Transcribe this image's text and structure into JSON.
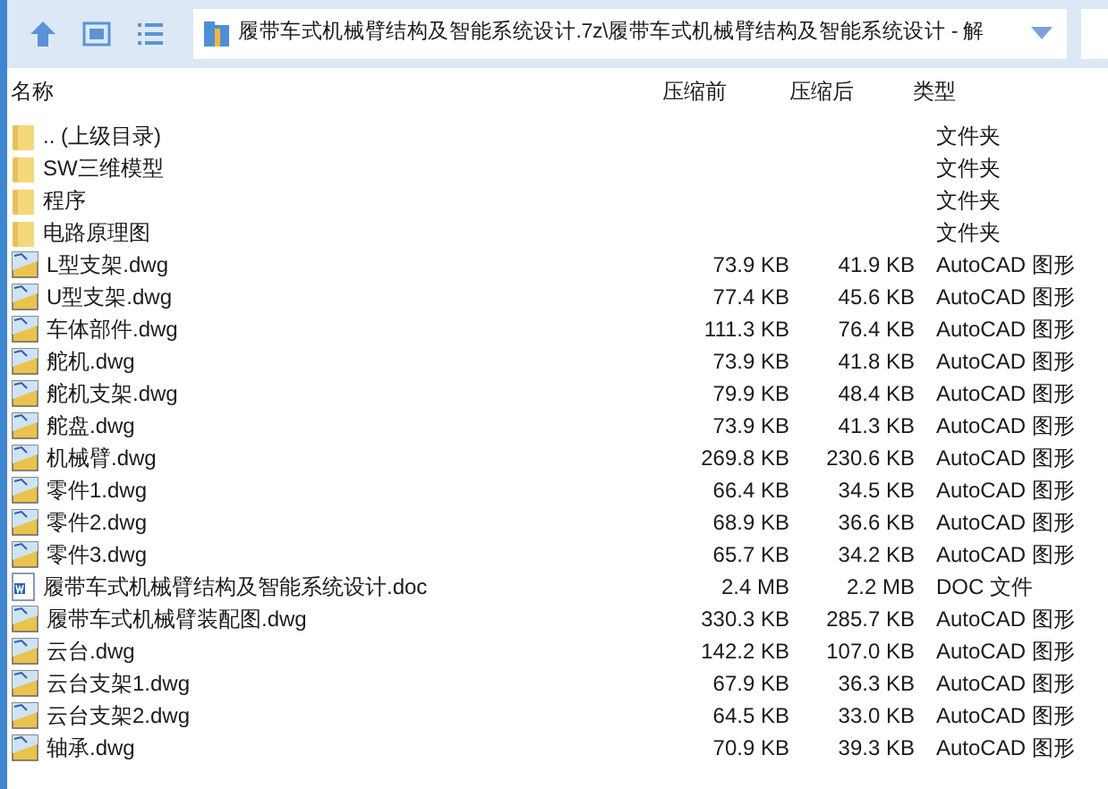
{
  "toolbar": {
    "path": "履带车式机械臂结构及智能系统设计.7z\\履带车式机械臂结构及智能系统设计 - 解"
  },
  "table": {
    "columns": [
      "名称",
      "压缩前",
      "压缩后",
      "类型"
    ],
    "rows": [
      {
        "kind": "folder",
        "name": ".. (上级目录)",
        "size": "",
        "packed": "",
        "type": "文件夹"
      },
      {
        "kind": "folder",
        "name": "SW三维模型",
        "size": "",
        "packed": "",
        "type": "文件夹"
      },
      {
        "kind": "folder",
        "name": "程序",
        "size": "",
        "packed": "",
        "type": "文件夹"
      },
      {
        "kind": "folder",
        "name": "电路原理图",
        "size": "",
        "packed": "",
        "type": "文件夹"
      },
      {
        "kind": "dwg",
        "name": "L型支架.dwg",
        "size": "73.9 KB",
        "packed": "41.9 KB",
        "type": "AutoCAD 图形"
      },
      {
        "kind": "dwg",
        "name": "U型支架.dwg",
        "size": "77.4 KB",
        "packed": "45.6 KB",
        "type": "AutoCAD 图形"
      },
      {
        "kind": "dwg",
        "name": "车体部件.dwg",
        "size": "111.3 KB",
        "packed": "76.4 KB",
        "type": "AutoCAD 图形"
      },
      {
        "kind": "dwg",
        "name": "舵机.dwg",
        "size": "73.9 KB",
        "packed": "41.8 KB",
        "type": "AutoCAD 图形"
      },
      {
        "kind": "dwg",
        "name": "舵机支架.dwg",
        "size": "79.9 KB",
        "packed": "48.4 KB",
        "type": "AutoCAD 图形"
      },
      {
        "kind": "dwg",
        "name": "舵盘.dwg",
        "size": "73.9 KB",
        "packed": "41.3 KB",
        "type": "AutoCAD 图形"
      },
      {
        "kind": "dwg",
        "name": "机械臂.dwg",
        "size": "269.8 KB",
        "packed": "230.6 KB",
        "type": "AutoCAD 图形"
      },
      {
        "kind": "dwg",
        "name": "零件1.dwg",
        "size": "66.4 KB",
        "packed": "34.5 KB",
        "type": "AutoCAD 图形"
      },
      {
        "kind": "dwg",
        "name": "零件2.dwg",
        "size": "68.9 KB",
        "packed": "36.6 KB",
        "type": "AutoCAD 图形"
      },
      {
        "kind": "dwg",
        "name": "零件3.dwg",
        "size": "65.7 KB",
        "packed": "34.2 KB",
        "type": "AutoCAD 图形"
      },
      {
        "kind": "doc",
        "name": "履带车式机械臂结构及智能系统设计.doc",
        "size": "2.4 MB",
        "packed": "2.2 MB",
        "type": "DOC 文件"
      },
      {
        "kind": "dwg",
        "name": "履带车式机械臂装配图.dwg",
        "size": "330.3 KB",
        "packed": "285.7 KB",
        "type": "AutoCAD 图形"
      },
      {
        "kind": "dwg",
        "name": "云台.dwg",
        "size": "142.2 KB",
        "packed": "107.0 KB",
        "type": "AutoCAD 图形"
      },
      {
        "kind": "dwg",
        "name": "云台支架1.dwg",
        "size": "67.9 KB",
        "packed": "36.3 KB",
        "type": "AutoCAD 图形"
      },
      {
        "kind": "dwg",
        "name": "云台支架2.dwg",
        "size": "64.5 KB",
        "packed": "33.0 KB",
        "type": "AutoCAD 图形"
      },
      {
        "kind": "dwg",
        "name": "轴承.dwg",
        "size": "70.9 KB",
        "packed": "39.3 KB",
        "type": "AutoCAD 图形"
      }
    ]
  }
}
